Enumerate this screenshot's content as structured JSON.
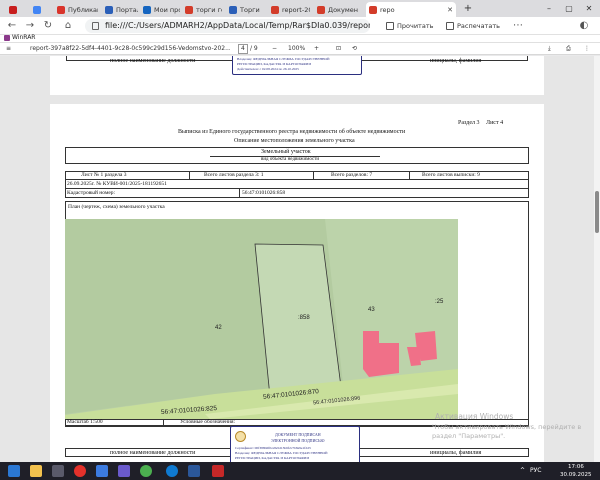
{
  "browser": {
    "tabs": [
      {
        "label": "",
        "color": "#c81e1e"
      },
      {
        "label": "",
        "color": "#4285f4"
      },
      {
        "label": "Публикаци",
        "color": "#d9342b"
      },
      {
        "label": "Портал п",
        "color": "#2b5fb8"
      },
      {
        "label": "Мои прос",
        "color": "#1565c0"
      },
      {
        "label": "торги гос",
        "color": "#d33c2a"
      },
      {
        "label": "Торги",
        "color": "#2b5fb8"
      },
      {
        "label": "report-20",
        "color": "#d33c2a"
      },
      {
        "label": "Докумен",
        "color": "#d33c2a"
      },
      {
        "label": "repo",
        "color": "#d33c2a",
        "active": true
      }
    ],
    "url": "file:///C:/Users/ADMARH2/AppData/Local/Temp/Rar$DIa0.039/report-...",
    "read_aloud": "Прочитать",
    "print_label": "Распечатать"
  },
  "bookmarks": {
    "item": "WinRAR"
  },
  "pdf": {
    "filename": "report-397a8f22-5df4-4401-9c28-0c599c29d156-Vedomstvo-202...",
    "page_current": "4",
    "page_total": "/ 9",
    "zoom": "100%"
  },
  "top_page": {
    "left_cell": "полное наименование должности",
    "right_cell": "инициалы, фамилия",
    "stamp_line1": "Владелец: ФЕДЕРАЛЬНАЯ СЛУЖБА ГОСУДАРСТВЕННОЙ",
    "stamp_line2": "РЕГИСТРАЦИИ, КАДАСТРА И КАРТОГРАФИИ",
    "stamp_line3": "Действителен: с 02.08.2024 по 26.10.2025"
  },
  "doc": {
    "section": "Раздел 3",
    "sheet": "Лист 4",
    "title": "Выписка из Единого государственного реестра недвижимости об объекте недвижимости",
    "subtitle": "Описание местоположения земельного участка",
    "object_type": "Земельный участок",
    "object_type_caption": "вид объекта недвижимости",
    "sheet_no": "Лист № 1 раздела 3",
    "total_sheets_section": "Всего листов раздела 3:  1",
    "total_sections": "Всего разделов: 7",
    "total_sheets": "Всего листов выписки:  9",
    "date_no": "26.09.2025г. № КУВИ-001/2025-181192651",
    "cadastral_label": "Кадастровый номер:",
    "cadastral_value": "56:47:0101026:858",
    "plan_label": "План (чертеж, схема) земельного участка",
    "scale_label": "Масштаб 1:500",
    "legend_label": "Условные обозначения:",
    "left_cell": "полное наименование должности",
    "right_cell": "инициалы, фамилия"
  },
  "map": {
    "labels": {
      "p42": "42",
      "p858": ":858",
      "p43": "43",
      "p25": ":25"
    },
    "street1": "56:47:0101026:825",
    "street2": "56:47:0101026:870",
    "street3": "56:47:0101026:896",
    "colors": {
      "grass": "#b8cfa3",
      "light": "#d6e6c9",
      "road": "#c8df9a",
      "building": "#f07088"
    }
  },
  "stamp2": {
    "line1": "ДОКУМЕНТ ПОДПИСАН",
    "line2": "ЭЛЕКТРОННОЙ ПОДПИСЬЮ",
    "line3": "Сертификат: 00f388b6f0ca8e5d13b6f2c7b8a9e1f2d3",
    "line4": "Владелец: ФЕДЕРАЛЬНАЯ СЛУЖБА ГОСУДАРСТВЕННОЙ",
    "line5": "РЕГИСТРАЦИИ, КАДАСТРА И КАРТОГРАФИИ"
  },
  "watermark": {
    "line1": "Активация Windows",
    "line2": "Чтобы активировать Windows, перейдите в",
    "line3": "раздел \"Параметры\"."
  },
  "taskbar": {
    "lang": "РУС",
    "time": "17:06",
    "date": "30.09.2025"
  }
}
